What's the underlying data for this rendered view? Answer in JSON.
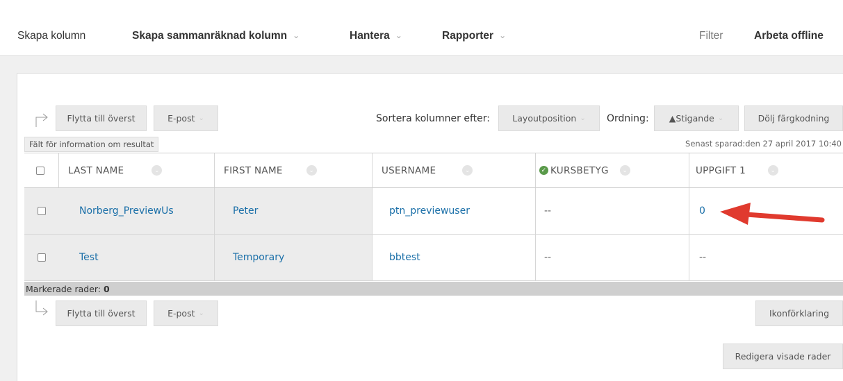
{
  "toolbar": {
    "create_column": "Skapa kolumn",
    "create_calc_column": "Skapa sammanräknad kolumn",
    "manage": "Hantera",
    "reports": "Rapporter",
    "filter": "Filter",
    "work_offline": "Arbeta offline"
  },
  "top_actions": {
    "move_top": "Flytta till överst",
    "email": "E-post",
    "sort_label": "Sortera kolumner efter:",
    "sort_value": "Layoutposition",
    "order_label": "Ordning:",
    "order_value": "▲Stigande",
    "hide_color": "Dölj färgkodning"
  },
  "info_tag": "Fält för information om resultat",
  "last_saved": "Senast sparad:den 27 april 2017 10:40",
  "columns": {
    "last_name": "LAST NAME",
    "first_name": "FIRST NAME",
    "username": "USERNAME",
    "course_grade": "KURSBETYG",
    "assignment1": "UPPGIFT 1"
  },
  "rows": [
    {
      "last_name": "Norberg_PreviewUs",
      "first_name": "Peter",
      "username": "ptn_previewuser",
      "course_grade": "--",
      "assignment1": "0"
    },
    {
      "last_name": "Test",
      "first_name": "Temporary",
      "username": "bbtest",
      "course_grade": "--",
      "assignment1": "--"
    }
  ],
  "marked_rows_label": "Markerade rader:",
  "marked_rows_count": "0",
  "bottom_actions": {
    "move_top": "Flytta till överst",
    "email": "E-post",
    "legend": "Ikonförklaring",
    "edit_rows": "Redigera visade rader"
  },
  "colors": {
    "link": "#1a6fa8",
    "annotation_arrow": "#e03a2e",
    "grade_check": "#5a9a4a"
  }
}
